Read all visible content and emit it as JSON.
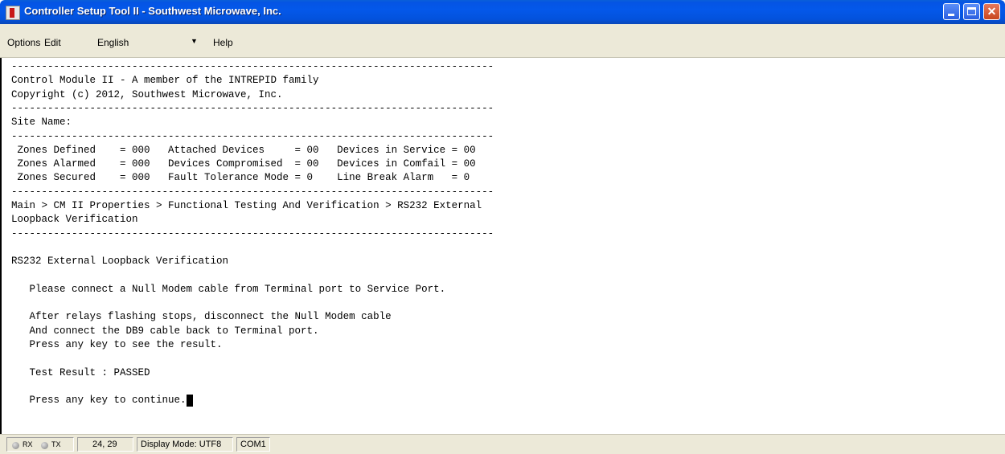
{
  "window": {
    "title": "Controller Setup Tool II - Southwest Microwave, Inc.",
    "app_icon": "app-icon"
  },
  "menu": {
    "options": "Options",
    "edit": "Edit",
    "language": "English",
    "help": "Help"
  },
  "terminal": {
    "lines": [
      "--------------------------------------------------------------------------------",
      "Control Module II - A member of the INTREPID family",
      "Copyright (c) 2012, Southwest Microwave, Inc.",
      "--------------------------------------------------------------------------------",
      "Site Name:",
      "--------------------------------------------------------------------------------",
      " Zones Defined    = 000   Attached Devices     = 00   Devices in Service = 00",
      " Zones Alarmed    = 000   Devices Compromised  = 00   Devices in Comfail = 00",
      " Zones Secured    = 000   Fault Tolerance Mode = 0    Line Break Alarm   = 0",
      "--------------------------------------------------------------------------------",
      "Main > CM II Properties > Functional Testing And Verification > RS232 External",
      "Loopback Verification",
      "--------------------------------------------------------------------------------",
      "",
      "RS232 External Loopback Verification",
      "",
      "   Please connect a Null Modem cable from Terminal port to Service Port.",
      "",
      "   After relays flashing stops, disconnect the Null Modem cable",
      "   And connect the DB9 cable back to Terminal port.",
      "   Press any key to see the result.",
      "",
      "   Test Result : PASSED",
      "",
      "   Press any key to continue."
    ]
  },
  "status": {
    "rx_label": "RX",
    "tx_label": "TX",
    "cursor_position": "24, 29",
    "display_mode": "Display Mode: UTF8",
    "port": "COM1"
  }
}
